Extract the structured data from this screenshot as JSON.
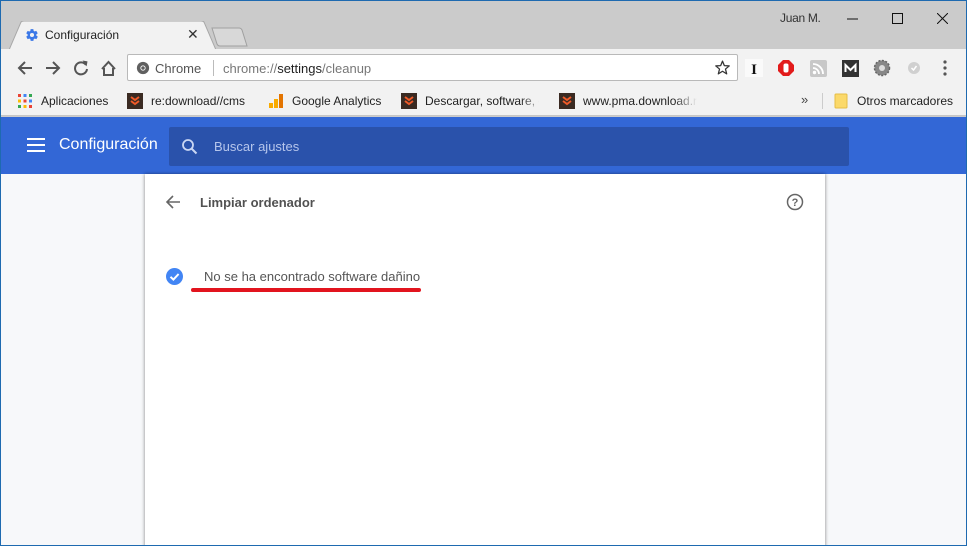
{
  "window": {
    "user_name": "Juan M.",
    "controls": {
      "minimize": "minimize",
      "maximize": "maximize",
      "close": "close"
    }
  },
  "tab": {
    "title": "Configuración",
    "icon": "gear-icon",
    "close_glyph": "✕"
  },
  "toolbar": {
    "site_name": "Chrome",
    "url_prefix": "chrome://",
    "url_host": "settings",
    "url_path": "/cleanup",
    "extensions": [
      "instapaper-icon",
      "adblock-icon",
      "rss-icon",
      "mega-icon",
      "gear-extension-icon",
      "shield-extension-icon"
    ]
  },
  "bookmarks": {
    "items": [
      {
        "label": "Aplicaciones",
        "icon": "apps-grid-icon"
      },
      {
        "label": "re:download//cms",
        "icon": "download-site-icon"
      },
      {
        "label": "Google Analytics",
        "icon": "analytics-icon"
      },
      {
        "label": "Descargar, software, c",
        "icon": "download-site-icon"
      },
      {
        "label": "www.pma.download.r",
        "icon": "download-site-icon"
      }
    ],
    "overflow": "»",
    "other": "Otros marcadores"
  },
  "settings": {
    "title": "Configuración",
    "search_placeholder": "Buscar ajustes"
  },
  "page": {
    "title": "Limpiar ordenador",
    "status": "No se ha encontrado software dañino"
  },
  "colors": {
    "header_blue": "#3367d6",
    "search_blue": "#2a52ab",
    "check_blue": "#4285f4",
    "underline_red": "#e2141e"
  }
}
